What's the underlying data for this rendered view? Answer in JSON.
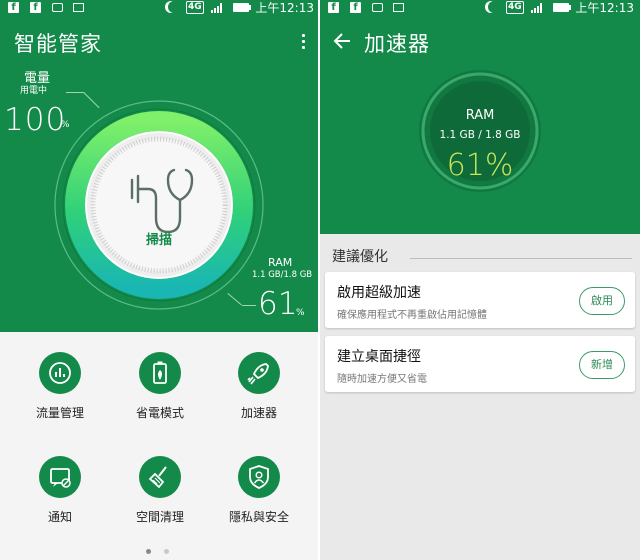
{
  "status_bar": {
    "network": "4G",
    "time": "上午12:13",
    "icons": [
      "facebook-icon",
      "facebook-icon",
      "message-icon",
      "photo-icon",
      "moon-icon",
      "signal-icon",
      "battery-icon"
    ]
  },
  "manager": {
    "title": "智能管家",
    "menu_icon": "more-vert-icon",
    "battery": {
      "label": "電量",
      "sublabel": "用電中",
      "value": "100",
      "unit": "%"
    },
    "ram": {
      "label": "RAM",
      "usage": "1.1 GB/1.8 GB",
      "value": "61",
      "unit": "%"
    },
    "scan_label": "掃描",
    "scan_icon": "stethoscope-icon",
    "grid": [
      {
        "label": "流量管理",
        "icon": "data-usage-icon"
      },
      {
        "label": "省電模式",
        "icon": "power-saving-icon"
      },
      {
        "label": "加速器",
        "icon": "rocket-icon"
      },
      {
        "label": "通知",
        "icon": "notification-icon"
      },
      {
        "label": "空間清理",
        "icon": "cleanup-broom-icon"
      },
      {
        "label": "隱私與安全",
        "icon": "privacy-shield-icon"
      }
    ],
    "pager": {
      "pages": 2,
      "current": 1
    }
  },
  "accelerator": {
    "title": "加速器",
    "back_icon": "back-arrow-icon",
    "ram": {
      "label": "RAM",
      "usage": "1.1 GB / 1.8 GB",
      "percent": "61%"
    },
    "section_title": "建議優化",
    "suggestions": [
      {
        "title": "啟用超級加速",
        "description": "確保應用程式不再重啟佔用記憶體",
        "action": "啟用"
      },
      {
        "title": "建立桌面捷徑",
        "description": "隨時加速方便又省電",
        "action": "新增"
      }
    ]
  },
  "colors": {
    "brand_green": "#148a4a",
    "gauge_dark": "#0e6a38",
    "accent_percent": "#c8e65a"
  }
}
